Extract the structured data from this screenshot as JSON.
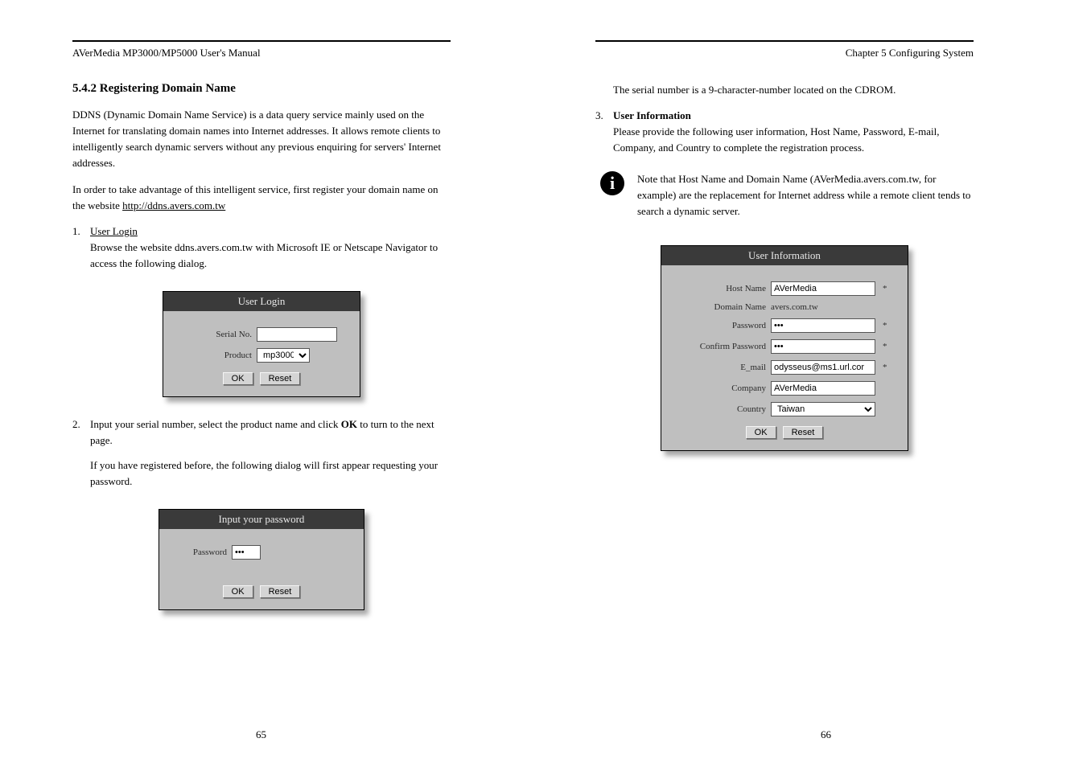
{
  "left": {
    "header": "AVerMedia MP3000/MP5000 User's Manual",
    "sectionNum": "5.4.2 Registering Domain Name",
    "intro": "DDNS (Dynamic Domain Name Service) is a data query service mainly used on the Internet for translating domain names into Internet addresses. It allows remote clients to intelligently search dynamic servers without any previous enquiring for servers' Internet addresses.",
    "para2": "In order to take advantage of this intelligent service, first register your domain name on the website ",
    "link": "http://ddns.avers.com.tw",
    "steps": [
      {
        "num": "1.",
        "preText": "",
        "title": "User Login",
        "text": "Browse the website ddns.avers.com.tw with Microsoft IE or Netscape Navigator to access the following dialog."
      },
      {
        "num": "2.",
        "preText": "Input your serial number, select the product name and click ",
        "bold": "OK",
        "postText": " to turn to the next page."
      },
      {
        "num": "",
        "preText": "If you have registered before, the following dialog will first appear requesting your ",
        "bold": "",
        "postText": "password."
      }
    ],
    "loginPanel": {
      "title": "User Login",
      "serialLabel": "Serial No.",
      "serialValue": "",
      "productLabel": "Product",
      "productValue": "mp3000",
      "ok": "OK",
      "reset": "Reset"
    },
    "pwdPanel": {
      "title": "Input your password",
      "passwordLabel": "Password",
      "passwordPlaceholder": "***",
      "ok": "OK",
      "reset": "Reset"
    },
    "pageNum": "65"
  },
  "right": {
    "header": "Chapter 5 Configuring System",
    "paraTop": "The serial number is a 9-character-number located on the CDROM.",
    "step3": {
      "num": "3.",
      "title": "User Information",
      "text": "Please provide the following user information, Host Name, Password, E-mail, Company, and Country to complete the registration process."
    },
    "infoNote": "Note that Host Name and Domain Name (AVerMedia.avers.com.tw, for example) are the replacement for Internet address while a remote client tends to search a dynamic server.",
    "userInfo": {
      "title": "User Information",
      "hostLabel": "Host Name",
      "hostValue": "AVerMedia",
      "domainLabel": "Domain Name",
      "domainValue": "avers.com.tw",
      "passwordLabel": "Password",
      "passwordValue": "***",
      "confirmLabel": "Confirm Password",
      "confirmValue": "***",
      "emailLabel": "E_mail",
      "emailValue": "odysseus@ms1.url.cor",
      "companyLabel": "Company",
      "companyValue": "AVerMedia",
      "countryLabel": "Country",
      "countryValue": "Taiwan",
      "ok": "OK",
      "reset": "Reset",
      "req": "*"
    },
    "pageNum": "66"
  }
}
